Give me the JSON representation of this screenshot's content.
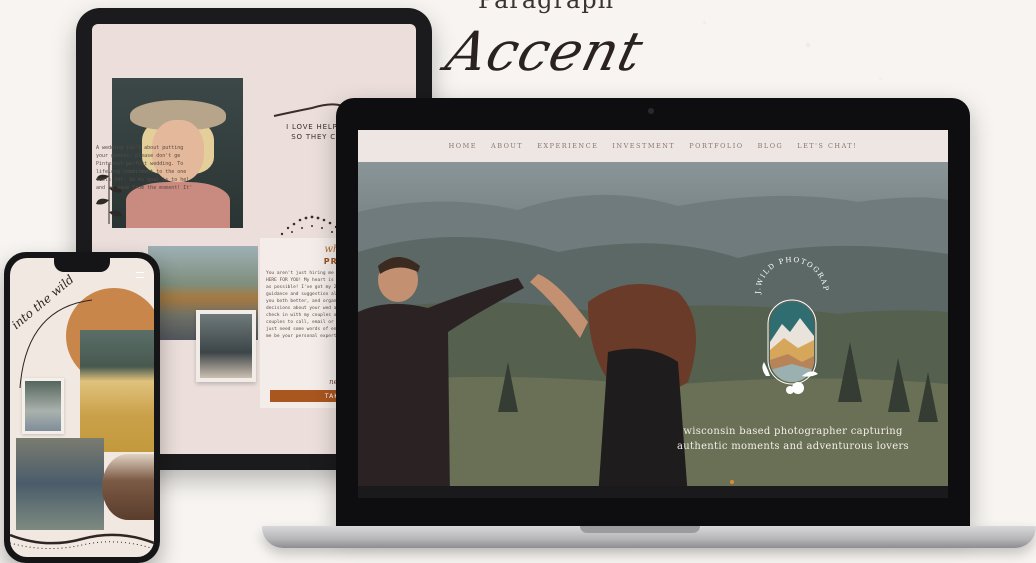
{
  "specimen": {
    "paragraph": "Paragraph",
    "accent": "Accent"
  },
  "tablet": {
    "heading_line1": "I LOVE HELPING COUPLES",
    "heading_line2": "SO THEY CAN FULLY BE",
    "body_left": "A wedding isn't about putting\nyour guests, please don't ge\nPinterest perfect wedding. To\nlifelong commitment to the one\nfeels for. So my goal is to hel\nand at ease from the moment! It'",
    "card_script": "what to e",
    "card_title": "PRE-WED",
    "card_body": "You aren't just hiring me to c your wedding day. From the l HERE FOR YOU! My heart is help make the wedding pl enjoyable as possible! I've got my 25+ page (Wild Wedding g tips, guidance and suggestion also receive a questionnaire t know you both better, and organize and plan as you bui big decisions about your wed also get your engagement sess I check in with my couples a tools that will ease the overw couples to call, email or text have questions, need vendor r just need some words of encou are you've never planned a we me be your personal expert!",
    "card_need_more": "need more",
    "card_button": "TAKE ME TO"
  },
  "phone": {
    "script": "into the wild"
  },
  "laptop": {
    "nav": [
      "HOME",
      "ABOUT",
      "EXPERIENCE",
      "INVESTMENT",
      "PORTFOLIO",
      "BLOG",
      "LET'S CHAT!"
    ],
    "logo_text": "J.WILD PHOTOGRAPHY",
    "tagline_line1": "wisconsin based photographer capturing",
    "tagline_line2": "authentic moments and adventurous lovers"
  },
  "colors": {
    "accent_orange": "#a9561f",
    "nav_bg": "#eee6e2",
    "tablet_bg": "#ecdfdb"
  }
}
